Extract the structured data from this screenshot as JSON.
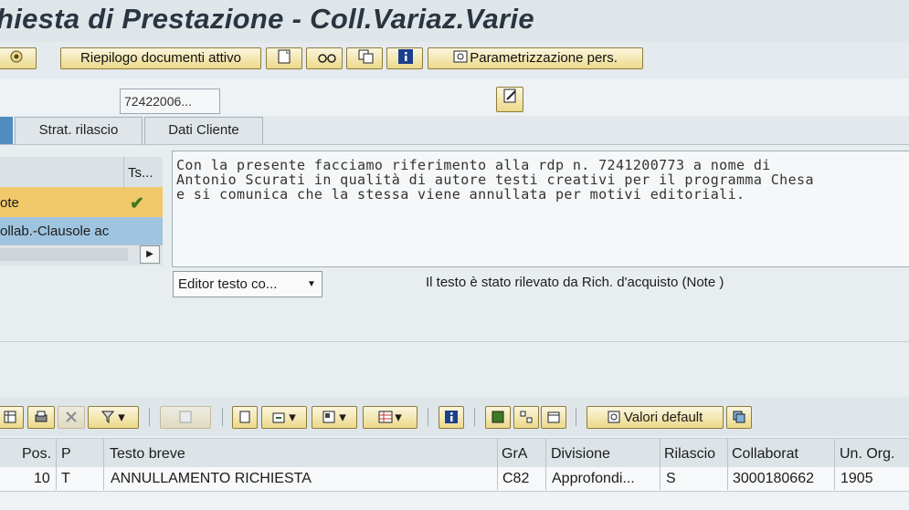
{
  "window": {
    "title": "hiesta di Prestazione - Coll.Variaz.Varie"
  },
  "toolbar": {
    "summary_button": "Riepilogo documenti attivo",
    "personalize_button": "Parametrizzazione pers.",
    "icons": [
      "display-icon",
      "new-document-icon",
      "glasses-icon",
      "copy-icon",
      "info-icon",
      "settings-icon"
    ]
  },
  "header": {
    "document_number": "72422006..."
  },
  "tabs": [
    {
      "label": "Strat. rilascio"
    },
    {
      "label": "Dati Cliente"
    }
  ],
  "text_types": {
    "header_col": "Ts...",
    "rows": [
      {
        "label": "ote",
        "status": "✔"
      },
      {
        "label": "ollab.-Clausole ac"
      }
    ]
  },
  "editor": {
    "lines": [
      "Con la presente facciamo riferimento alla rdp n. 7241200773 a nome di",
      "Antonio Scurati in qualità di autore testi creativi per il programma Chesa",
      "e si comunica che la stessa viene annullata per motivi editoriali."
    ],
    "mode_select": "Editor testo co...",
    "status": "Il testo è stato rilevato da Rich. d'acquisto (Note )"
  },
  "items_toolbar": {
    "defaults_button": "Valori default"
  },
  "items_table": {
    "columns": [
      "Pos.",
      "P",
      "Testo breve",
      "GrA",
      "Divisione",
      "Rilascio",
      "Collaborat",
      "Un. Org."
    ],
    "rows": [
      {
        "pos": "10",
        "p": "T",
        "text": "ANNULLAMENTO RICHIESTA",
        "gra": "C82",
        "division": "Approfondi...",
        "release": "S",
        "collaborator": "3000180662",
        "org_unit": "1905"
      }
    ]
  },
  "colors": {
    "button_gradient_top": "#fbf6de",
    "button_gradient_bottom": "#ecd98a",
    "selected_row": "#f1c96a",
    "highlight_row": "#9fc4df"
  }
}
